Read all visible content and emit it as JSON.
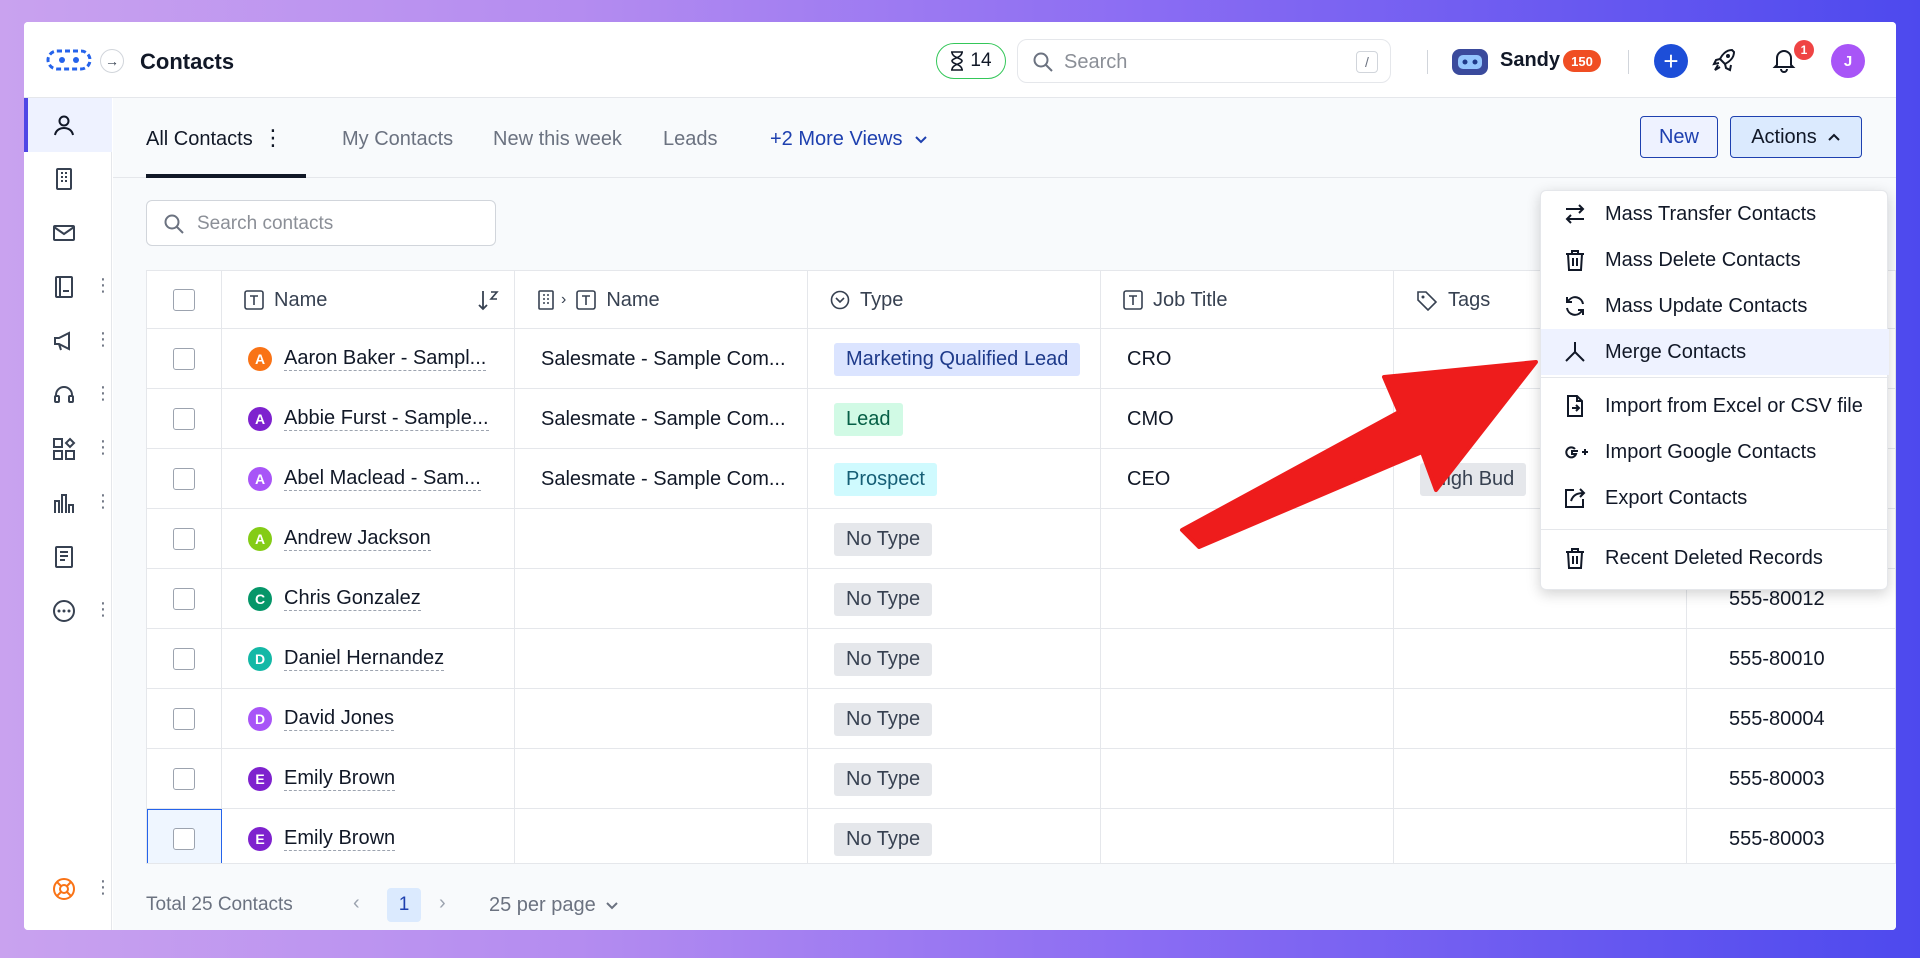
{
  "header": {
    "title": "Contacts",
    "timer_count": "14",
    "search_placeholder": "Search",
    "search_shortcut": "/",
    "user_name": "Sandy",
    "points": "150",
    "notification_count": "1",
    "avatar_initial": "J"
  },
  "sidebar": {
    "items": [
      {
        "icon": "person-icon",
        "active": true
      },
      {
        "icon": "building-icon"
      },
      {
        "icon": "mail-icon"
      },
      {
        "icon": "ledger-icon",
        "has_more": true
      },
      {
        "icon": "megaphone-icon",
        "has_more": true
      },
      {
        "icon": "headset-icon",
        "has_more": true
      },
      {
        "icon": "apps-icon",
        "has_more": true
      },
      {
        "icon": "reports-icon",
        "has_more": true
      },
      {
        "icon": "document-icon"
      },
      {
        "icon": "more-circle-icon",
        "has_more": true
      }
    ],
    "help_icon": "lifebuoy-icon"
  },
  "views": {
    "tabs": [
      "All Contacts",
      "My Contacts",
      "New this week",
      "Leads"
    ],
    "active_tab": "All Contacts",
    "more_views": "+2 More Views",
    "new_label": "New",
    "actions_label": "Actions"
  },
  "list_search_placeholder": "Search contacts",
  "table": {
    "columns": [
      "Name",
      "Name",
      "Type",
      "Job Title",
      "Tags"
    ],
    "rows": [
      {
        "initial": "A",
        "color": "#f97316",
        "name": "Aaron Baker - Sampl...",
        "company": "Salesmate - Sample Com...",
        "type": "Marketing Qualified Lead",
        "type_bg": "#dbe4ff",
        "type_fg": "#1e3a8a",
        "job": "CRO",
        "tag": "",
        "phone": ""
      },
      {
        "initial": "A",
        "color": "#7e22ce",
        "name": "Abbie Furst - Sample...",
        "company": "Salesmate - Sample Com...",
        "type": "Lead",
        "type_bg": "#d1fae5",
        "type_fg": "#065f46",
        "job": "CMO",
        "tag": "",
        "phone": ""
      },
      {
        "initial": "A",
        "color": "#a855f7",
        "name": "Abel Maclead - Sam...",
        "company": "Salesmate - Sample Com...",
        "type": "Prospect",
        "type_bg": "#cffafe",
        "type_fg": "#155e75",
        "job": "CEO",
        "tag": "High Bud",
        "phone": ""
      },
      {
        "initial": "A",
        "color": "#84cc16",
        "name": "Andrew Jackson",
        "company": "",
        "type": "No Type",
        "type_bg": "#e5e7eb",
        "type_fg": "#374151",
        "job": "",
        "tag": "",
        "phone": ""
      },
      {
        "initial": "C",
        "color": "#059669",
        "name": "Chris Gonzalez",
        "company": "",
        "type": "No Type",
        "type_bg": "#e5e7eb",
        "type_fg": "#374151",
        "job": "",
        "tag": "",
        "phone": "555-80012"
      },
      {
        "initial": "D",
        "color": "#14b8a6",
        "name": "Daniel Hernandez",
        "company": "",
        "type": "No Type",
        "type_bg": "#e5e7eb",
        "type_fg": "#374151",
        "job": "",
        "tag": "",
        "phone": "555-80010"
      },
      {
        "initial": "D",
        "color": "#a855f7",
        "name": "David Jones",
        "company": "",
        "type": "No Type",
        "type_bg": "#e5e7eb",
        "type_fg": "#374151",
        "job": "",
        "tag": "",
        "phone": "555-80004"
      },
      {
        "initial": "E",
        "color": "#7e22ce",
        "name": "Emily Brown",
        "company": "",
        "type": "No Type",
        "type_bg": "#e5e7eb",
        "type_fg": "#374151",
        "job": "",
        "tag": "",
        "phone": "555-80003"
      },
      {
        "initial": "E",
        "color": "#7e22ce",
        "name": "Emily Brown",
        "company": "",
        "type": "No Type",
        "type_bg": "#e5e7eb",
        "type_fg": "#374151",
        "job": "",
        "tag": "",
        "phone": "555-80003"
      }
    ]
  },
  "footer": {
    "total": "Total 25 Contacts",
    "page": "1",
    "per_page": "25 per page"
  },
  "actions_menu": {
    "items": [
      {
        "label": "Mass Transfer Contacts",
        "icon": "transfer-icon"
      },
      {
        "label": "Mass Delete Contacts",
        "icon": "trash-icon"
      },
      {
        "label": "Mass Update Contacts",
        "icon": "refresh-icon"
      },
      {
        "label": "Merge Contacts",
        "icon": "merge-icon",
        "highlighted": true
      },
      {
        "label": "Import from Excel or CSV file",
        "icon": "file-import-icon"
      },
      {
        "label": "Import Google Contacts",
        "icon": "google-plus-icon"
      },
      {
        "label": "Export Contacts",
        "icon": "export-icon"
      },
      {
        "label": "Recent Deleted Records",
        "icon": "trash-icon"
      }
    ]
  },
  "annotation_color": "#ee1c1c"
}
